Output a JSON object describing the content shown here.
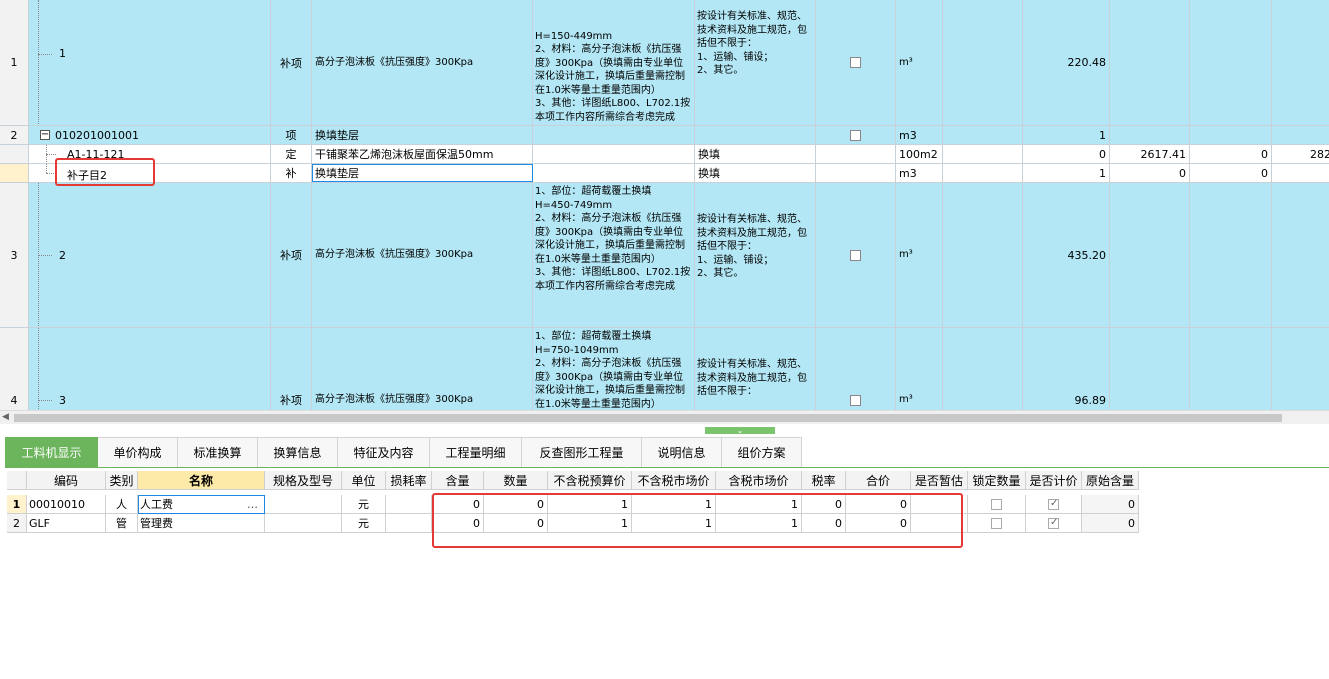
{
  "top_rows": [
    {
      "no": "1",
      "code": "1",
      "cat": "补项",
      "name": "高分子泡沫板《抗压强度》300Kpa",
      "feature": "H=150-449mm\n2、材料：高分子泡沫板《抗压强度》300Kpa（换填需由专业单位深化设计施工，换填后重量需控制在1.0米等量土重量范围内）\n3、其他：详图纸L800、L702.1按本项工作内容所需综合考虑完成",
      "content": "按设计有关标准、规范、技术资料及施工规范，包括但不限于：\n1、运输、铺设；\n2、其它。",
      "unit": "m³",
      "qty": "220.48"
    },
    {
      "no": "2",
      "code": "010201001001",
      "cat": "项",
      "name": "换填垫层",
      "unit": "m3",
      "qty": "1"
    },
    {
      "no": "",
      "code": "A1-11-121",
      "cat": "定",
      "name": "干铺聚苯乙烯泡沫板屋面保温50mm",
      "content": "换填",
      "unit": "100m2",
      "qty": "0",
      "v1": "2617.41",
      "v2": "0",
      "v3": "282"
    },
    {
      "no": "",
      "code": "补子目2",
      "cat": "补",
      "name": "换填垫层",
      "content": "换填",
      "unit": "m3",
      "qty": "1",
      "v1": "0",
      "v2": "0"
    },
    {
      "no": "3",
      "code": "2",
      "cat": "补项",
      "name": "高分子泡沫板《抗压强度》300Kpa",
      "feature": "1、部位：超荷载覆土换填\nH=450-749mm\n2、材料：高分子泡沫板《抗压强度》300Kpa（换填需由专业单位深化设计施工，换填后重量需控制在1.0米等量土重量范围内）\n3、其他：详图纸L800、L702.1按本项工作内容所需综合考虑完成",
      "content": "按设计有关标准、规范、技术资料及施工规范，包括但不限于：\n1、运输、铺设；\n2、其它。",
      "unit": "m³",
      "qty": "435.20"
    },
    {
      "no": "4",
      "code": "3",
      "cat": "补项",
      "name": "高分子泡沫板《抗压强度》300Kpa",
      "feature": "1、部位：超荷载覆土换填\nH=750-1049mm\n2、材料：高分子泡沫板《抗压强度》300Kpa（换填需由专业单位深化设计施工，换填后重量需控制在1.0米等量土重量范围内）",
      "content": "按设计有关标准、规范、技术资料及施工规范，包括但不限于：",
      "unit": "m³",
      "qty": "96.89"
    }
  ],
  "tabs": [
    "工料机显示",
    "单价构成",
    "标准换算",
    "换算信息",
    "特征及内容",
    "工程量明细",
    "反查图形工程量",
    "说明信息",
    "组价方案"
  ],
  "grid": {
    "headers": [
      "编码",
      "类别",
      "名称",
      "规格及型号",
      "单位",
      "损耗率",
      "含量",
      "数量",
      "不含税预算价",
      "不含税市场价",
      "含税市场价",
      "税率",
      "合价",
      "是否暂估",
      "锁定数量",
      "是否计价",
      "原始含量"
    ],
    "rows": [
      {
        "no": "1",
        "code": "00010010",
        "cat": "人",
        "name": "人工费",
        "spec": "",
        "unit": "元",
        "loss": "",
        "content": "0",
        "qty": "0",
        "p1": "1",
        "p2": "1",
        "p3": "1",
        "tax": "0",
        "total": "0",
        "orig": "0"
      },
      {
        "no": "2",
        "code": "GLF",
        "cat": "管",
        "name": "管理费",
        "spec": "",
        "unit": "元",
        "loss": "",
        "content": "0",
        "qty": "0",
        "p1": "1",
        "p2": "1",
        "p3": "1",
        "tax": "0",
        "total": "0",
        "orig": "0"
      }
    ]
  },
  "icons": {
    "ellipsis": "…",
    "collapse": "−",
    "splitter": "chevron-down-icon",
    "scroll-left": "◀"
  }
}
